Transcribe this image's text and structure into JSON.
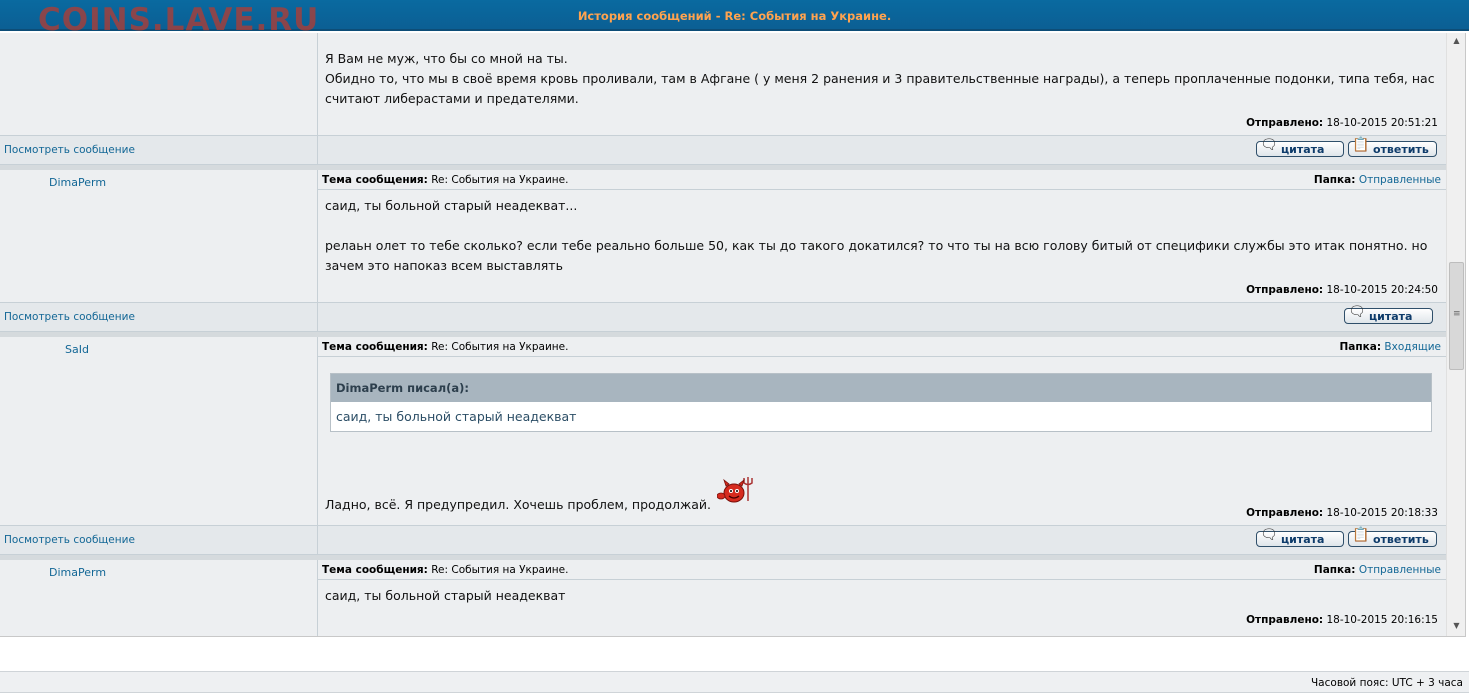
{
  "watermark": "COINS.LAVE.RU",
  "window": {
    "title": "История сообщений - Re: События на Украине."
  },
  "labels": {
    "subject_label": "Тема сообщения:",
    "folder_label": "Папка:",
    "posted_label": "Отправлено:",
    "view_message": "Посмотреть сообщение",
    "quote_button": "цитата",
    "reply_button": "ответить"
  },
  "messages": [
    {
      "lines": [
        "Я Вам не муж, что бы со мной на ты.",
        "Обидно то, что мы в своё время кровь проливали, там в Афгане ( у меня 2 ранения и 3 правительственные награды), а теперь проплаченные подонки, типа тебя, нас",
        "считают либерастами и предателями."
      ],
      "posted": "18-10-2015 20:51:21"
    },
    {
      "author": "DimaPerm",
      "subject": "Re: События на Украине.",
      "folder": "Отправленные",
      "lines": [
        "саид, ты больной старый неадекват...",
        "",
        "релаьн олет то тебе сколько? если тебе реально больше 50, как ты до такого докатился? то что ты на всю голову битый от специфики службы это итак понятно. но",
        "зачем это напоказ всем выставлять"
      ],
      "posted": "18-10-2015 20:24:50"
    },
    {
      "author": "SaId",
      "subject": "Re: События на Украине.",
      "folder": "Входящие",
      "quote_author": "DimaPerm писал(а):",
      "quote_text": "саид, ты больной старый неадекват",
      "text": "Ладно, всё. Я предупредил. Хочешь проблем, продолжай.",
      "posted": "18-10-2015 20:18:33"
    },
    {
      "author": "DimaPerm",
      "subject": "Re: События на Украине.",
      "folder": "Отправленные",
      "text": "саид, ты больной старый неадекват",
      "posted": "18-10-2015 20:16:15"
    }
  ],
  "footer": {
    "timezone": "Часовой пояс: UTC + 3 часа"
  }
}
